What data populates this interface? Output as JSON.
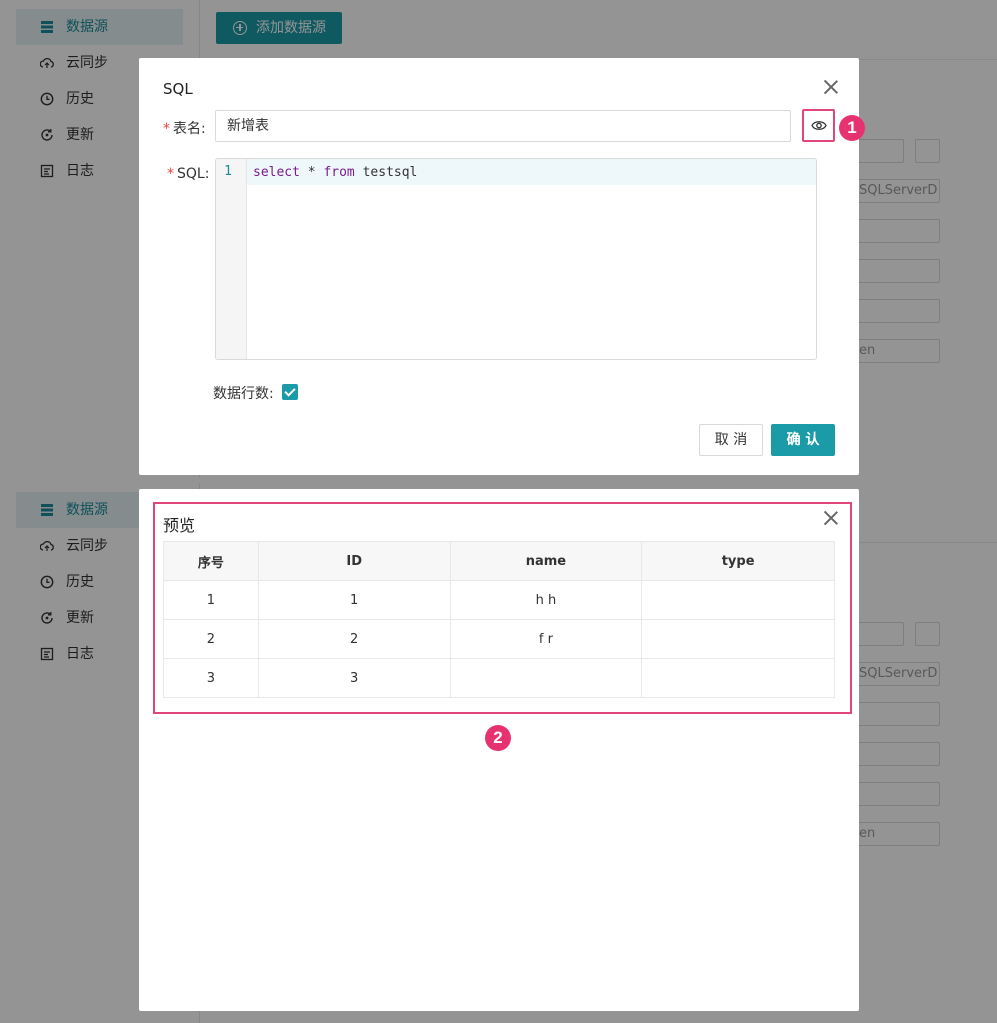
{
  "sidebar": {
    "items": [
      {
        "label": "数据源",
        "icon": "database-icon",
        "active": true
      },
      {
        "label": "云同步",
        "icon": "cloud-sync-icon",
        "active": false
      },
      {
        "label": "历史",
        "icon": "clock-icon",
        "active": false
      },
      {
        "label": "更新",
        "icon": "refresh-icon",
        "active": false
      },
      {
        "label": "日志",
        "icon": "log-icon",
        "active": false
      }
    ]
  },
  "toolbar": {
    "add_datasource_label": "添加数据源"
  },
  "background_fields": {
    "driver_fragment": "SQLServerD",
    "token_fragment": "en"
  },
  "sql_dialog": {
    "title": "SQL",
    "name_label": "表名:",
    "name_value": "新增表",
    "sql_label": "SQL:",
    "editor": {
      "line_number": "1",
      "kw_select": "select",
      "mid": " * ",
      "kw_from": "from",
      "table": " testsql"
    },
    "rows_label": "数据行数:",
    "rows_checked": true,
    "cancel_label": "取 消",
    "confirm_label": "确 认",
    "badge": "1"
  },
  "preview_dialog": {
    "title": "预览",
    "badge": "2",
    "columns": [
      "序号",
      "ID",
      "name",
      "type"
    ],
    "rows": [
      [
        "1",
        "1",
        "h h",
        ""
      ],
      [
        "2",
        "2",
        "f r",
        ""
      ],
      [
        "3",
        "3",
        "",
        ""
      ]
    ]
  },
  "colors": {
    "accent": "#1b9aa8",
    "highlight": "#e0457b",
    "badge": "#e6336f"
  }
}
